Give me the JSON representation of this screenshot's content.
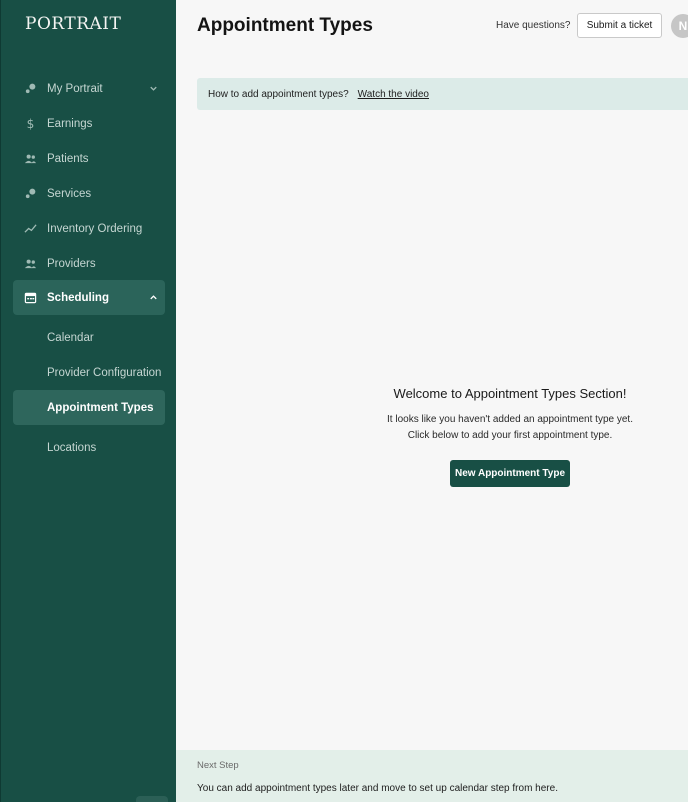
{
  "sidebar": {
    "logo": "PORTRAIT",
    "items": [
      {
        "label": "My Portrait",
        "icon": "dots-icon"
      },
      {
        "label": "Earnings",
        "icon": "dollar-icon"
      },
      {
        "label": "Patients",
        "icon": "people-icon"
      },
      {
        "label": "Services",
        "icon": "dots-icon"
      },
      {
        "label": "Inventory Ordering",
        "icon": "trend-icon"
      },
      {
        "label": "Providers",
        "icon": "people-icon"
      },
      {
        "label": "Scheduling",
        "icon": "calendar-icon"
      }
    ],
    "sub_items": [
      {
        "label": "Calendar"
      },
      {
        "label": "Provider Configuration"
      },
      {
        "label": "Appointment Types"
      },
      {
        "label": "Locations"
      }
    ]
  },
  "header": {
    "title": "Appointment Types",
    "help_text": "Have questions?",
    "ticket_button": "Submit a ticket",
    "avatar_initial": "N"
  },
  "banner": {
    "text": "How to add appointment types?",
    "link": "Watch the video"
  },
  "empty_state": {
    "title": "Welcome to Appointment Types Section!",
    "line1": "It looks like you haven't added an appointment type yet.",
    "line2": "Click below to add your first appointment type.",
    "button": "New Appointment Type"
  },
  "footer": {
    "label": "Next Step",
    "text": "You can add appointment types later and move to set up calendar step from here."
  },
  "colors": {
    "sidebar_bg": "#184f45",
    "primary_button": "#184f45",
    "banner_bg": "#dcebe8",
    "footer_bg": "#e3efe9"
  }
}
